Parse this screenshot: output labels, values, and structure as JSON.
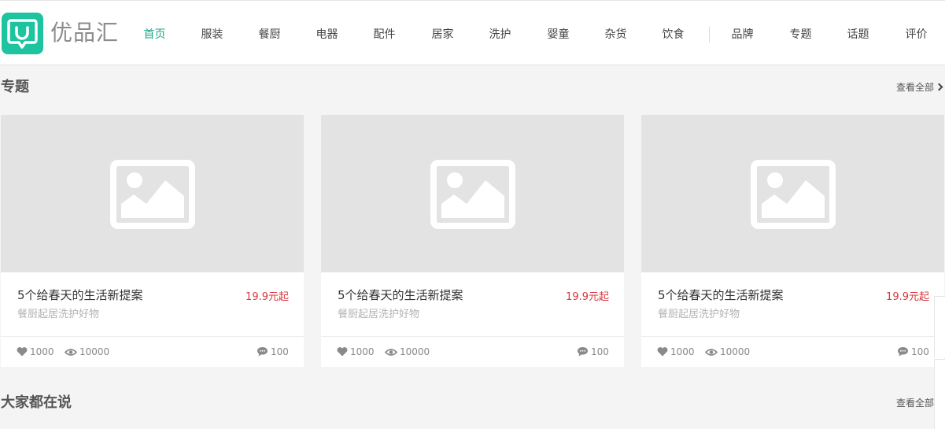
{
  "brand": {
    "name": "优品汇",
    "accent": "#1ec3a0"
  },
  "nav": {
    "items": [
      "首页",
      "服装",
      "餐厨",
      "电器",
      "配件",
      "居家",
      "洗护",
      "婴童",
      "杂货",
      "饮食",
      "品牌",
      "专题",
      "话题",
      "评价"
    ],
    "active_index": 0
  },
  "sections": [
    {
      "title": "专题",
      "view_all": "查看全部"
    },
    {
      "title": "大家都在说",
      "view_all": "查看全部"
    }
  ],
  "cards": [
    {
      "title": "5个给春天的生活新提案",
      "price": "19.9元起",
      "subtitle": "餐厨起居洗护好物",
      "likes": "1000",
      "views": "10000",
      "comments": "100",
      "image_icon": "image-placeholder-icon"
    },
    {
      "title": "5个给春天的生活新提案",
      "price": "19.9元起",
      "subtitle": "餐厨起居洗护好物",
      "likes": "1000",
      "views": "10000",
      "comments": "100",
      "image_icon": "image-placeholder-icon"
    },
    {
      "title": "5个给春天的生活新提案",
      "price": "19.9元起",
      "subtitle": "餐厨起居洗护好物",
      "likes": "1000",
      "views": "10000",
      "comments": "100",
      "image_icon": "image-placeholder-icon"
    }
  ],
  "colors": {
    "price": "#d9363e",
    "active_nav": "#1ea88c"
  }
}
